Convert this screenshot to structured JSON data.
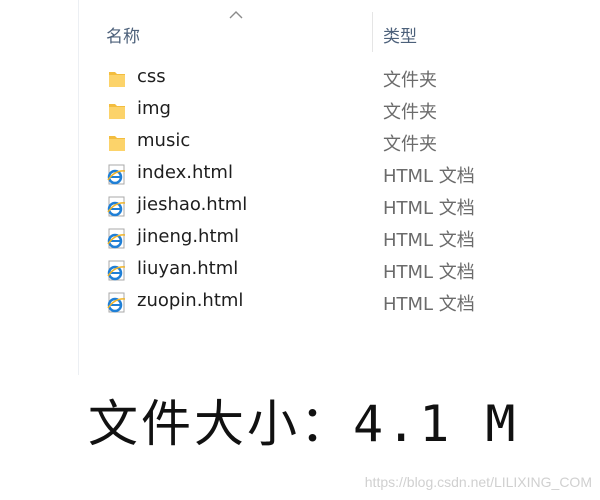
{
  "columns": {
    "name": "名称",
    "type": "类型"
  },
  "files": [
    {
      "name": "css",
      "type": "文件夹",
      "icon": "folder-icon"
    },
    {
      "name": "img",
      "type": "文件夹",
      "icon": "folder-icon"
    },
    {
      "name": "music",
      "type": "文件夹",
      "icon": "folder-icon"
    },
    {
      "name": "index.html",
      "type": "HTML 文档",
      "icon": "ie-html-icon"
    },
    {
      "name": "jieshao.html",
      "type": "HTML 文档",
      "icon": "ie-html-icon"
    },
    {
      "name": "jineng.html",
      "type": "HTML 文档",
      "icon": "ie-html-icon"
    },
    {
      "name": "liuyan.html",
      "type": "HTML 文档",
      "icon": "ie-html-icon"
    },
    {
      "name": "zuopin.html",
      "type": "HTML 文档",
      "icon": "ie-html-icon"
    }
  ],
  "caption": "文件大小：4.1 M",
  "watermark": "https://blog.csdn.net/LILIXING_COM",
  "colors": {
    "folder": "#f5c34d",
    "ie_blue": "#1f7fd6",
    "header_text": "#4c607a"
  }
}
